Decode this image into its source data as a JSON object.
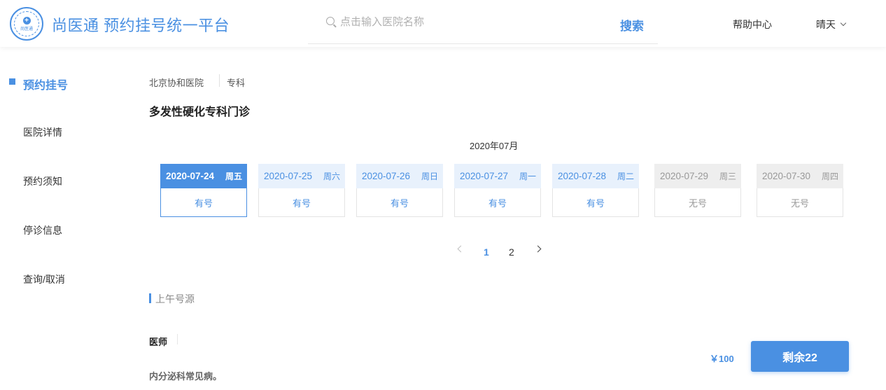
{
  "header": {
    "logo_text": "尚医通",
    "site_title": "尚医通 预约挂号统一平台",
    "search_placeholder": "点击输入医院名称",
    "search_button": "搜索",
    "help_link": "帮助中心",
    "user_name": "晴天"
  },
  "sidebar": {
    "items": [
      {
        "label": "预约挂号",
        "active": true
      },
      {
        "label": "医院详情"
      },
      {
        "label": "预约须知"
      },
      {
        "label": "停诊信息"
      },
      {
        "label": "查询/取消"
      }
    ]
  },
  "breadcrumb": {
    "hospital": "北京协和医院",
    "category": "专科"
  },
  "department": "多发性硬化专科门诊",
  "month": "2020年07月",
  "days": [
    {
      "date": "2020-07-24",
      "weekday": "周五",
      "status": "有号",
      "state": "selected"
    },
    {
      "date": "2020-07-25",
      "weekday": "周六",
      "status": "有号",
      "state": "available"
    },
    {
      "date": "2020-07-26",
      "weekday": "周日",
      "status": "有号",
      "state": "available"
    },
    {
      "date": "2020-07-27",
      "weekday": "周一",
      "status": "有号",
      "state": "available"
    },
    {
      "date": "2020-07-28",
      "weekday": "周二",
      "status": "有号",
      "state": "available"
    },
    {
      "date": "2020-07-29",
      "weekday": "周三",
      "status": "无号",
      "state": "full"
    },
    {
      "date": "2020-07-30",
      "weekday": "周四",
      "status": "无号",
      "state": "full"
    }
  ],
  "pager": {
    "pages": [
      "1",
      "2"
    ],
    "current": "1"
  },
  "section": {
    "title": "上午号源"
  },
  "doctor": {
    "label": "医师",
    "skill": "内分泌科常见病。",
    "price": "￥100",
    "remaining_button": "剩余22"
  },
  "colors": {
    "accent": "#4a90e2",
    "accent_light": "#e8f1fc",
    "disabled": "#eeeeee"
  }
}
